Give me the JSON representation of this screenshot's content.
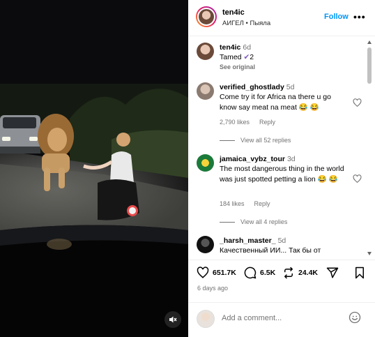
{
  "header": {
    "username": "ten4ic",
    "subtitle": "АИГЕЛ • Пыяла",
    "follow_label": "Follow",
    "more_label": "•••"
  },
  "caption": {
    "username": "ten4ic",
    "time": "6d",
    "text": "Tamed",
    "emoji_after": "✔",
    "count": "2",
    "see_original": "See original"
  },
  "comments": [
    {
      "username": "verified_ghostlady",
      "time": "5d",
      "text": "Come try it for Africa na there u go know say meat na meat 😂 😂",
      "likes": "2,790 likes",
      "reply": "Reply",
      "view_replies": "View all 52 replies"
    },
    {
      "username": "jamaica_vybz_tour",
      "time": "3d",
      "text": "The most dangerous thing in the world was just spotted petting a lion 😂 😂",
      "likes": "184 likes",
      "reply": "Reply",
      "view_replies": "View all 4 replies"
    },
    {
      "username": "_harsh_master_",
      "time": "5d",
      "text": "Качественный ИИ... Так бы от"
    }
  ],
  "actions": {
    "likes": "651.7K",
    "comments": "6.5K",
    "reposts": "24.4K",
    "posted": "6 days ago"
  },
  "add_comment": {
    "placeholder": "Add a comment..."
  },
  "icons": {
    "mute": "speaker-muted-icon",
    "heart": "heart-icon",
    "comment": "comment-icon",
    "repost": "repost-icon",
    "share": "send-icon",
    "save": "bookmark-icon",
    "emoji": "smiley-icon"
  },
  "colors": {
    "accent": "#0095f6",
    "verified": "#7e57c2",
    "muted_text": "#737373"
  }
}
